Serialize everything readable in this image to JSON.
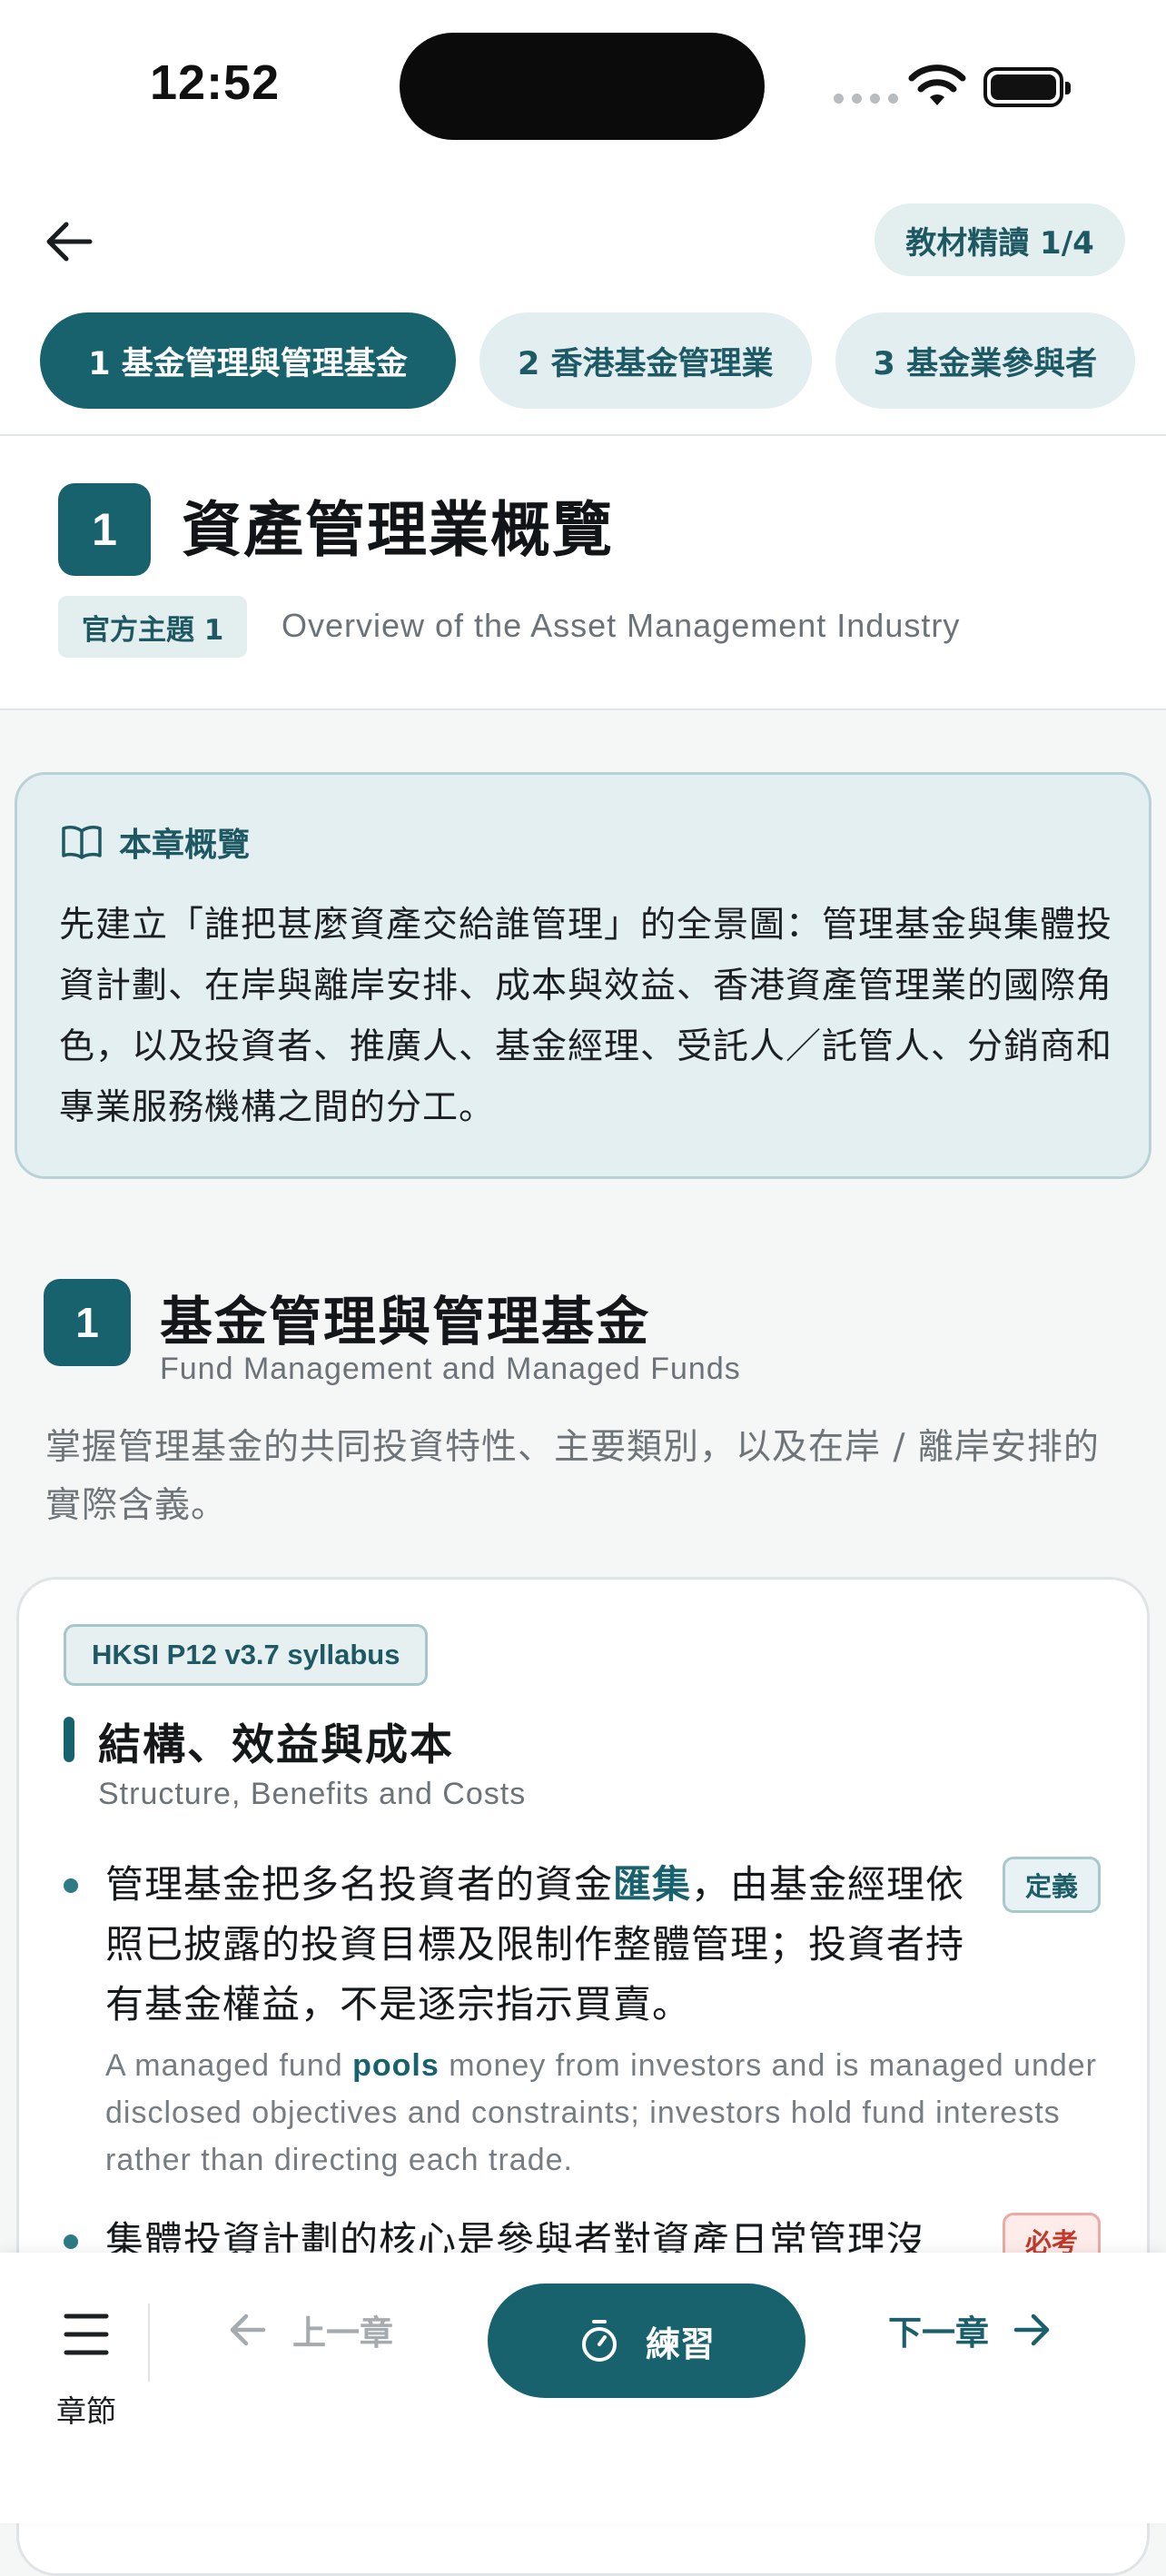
{
  "status": {
    "time": "12:52"
  },
  "header": {
    "progress": "教材精讀 1/4",
    "tabs": [
      {
        "label": "1 基金管理與管理基金",
        "active": true
      },
      {
        "label": "2 香港基金管理業",
        "active": false
      },
      {
        "label": "3 基金業參與者",
        "active": false
      }
    ]
  },
  "chapter": {
    "number": "1",
    "title": "資產管理業概覽",
    "topic_tag": "官方主題 1",
    "title_en": "Overview of the Asset Management Industry"
  },
  "overview": {
    "heading": "本章概覽",
    "icon": "open-book-icon",
    "text": "先建立「誰把甚麼資產交給誰管理」的全景圖：管理基金與集體投資計劃、在岸與離岸安排、成本與效益、香港資產管理業的國際角色，以及投資者、推廣人、基金經理、受託人／託管人、分銷商和專業服務機構之間的分工。"
  },
  "section": {
    "number": "1",
    "title": "基金管理與管理基金",
    "title_en": "Fund Management and Managed Funds",
    "description": "掌握管理基金的共同投資特性、主要類別，以及在岸 / 離岸安排的實際含義。"
  },
  "card": {
    "syllabus": "HKSI P12 v3.7 syllabus",
    "topic_title": "結構、效益與成本",
    "topic_en": "Structure, Benefits and Costs",
    "points": [
      {
        "zh_before": "管理基金把多名投資者的資金",
        "zh_highlight": "匯集",
        "zh_after": "，由基金經理依照已披露的投資目標及限制作整體管理；投資者持有基金權益，不是逐宗指示買賣。",
        "label": "定義",
        "en_before": "A managed fund ",
        "en_highlight": "pools",
        "en_after": " money from investors and is managed under disclosed objectives and constraints; investors hold fund interests rather than directing each trade."
      },
      {
        "zh": "集體投資計劃的核心是參與者對資產日常管理沒",
        "label": "必考"
      }
    ]
  },
  "bottom": {
    "menu_label": "章節",
    "prev": "上一章",
    "practice": "練習",
    "next": "下一章"
  },
  "colors": {
    "primary": "#17626d",
    "tab_inactive_bg": "#e2eeef",
    "overview_bg": "#e4eff1",
    "must_red": "#c0392b"
  }
}
